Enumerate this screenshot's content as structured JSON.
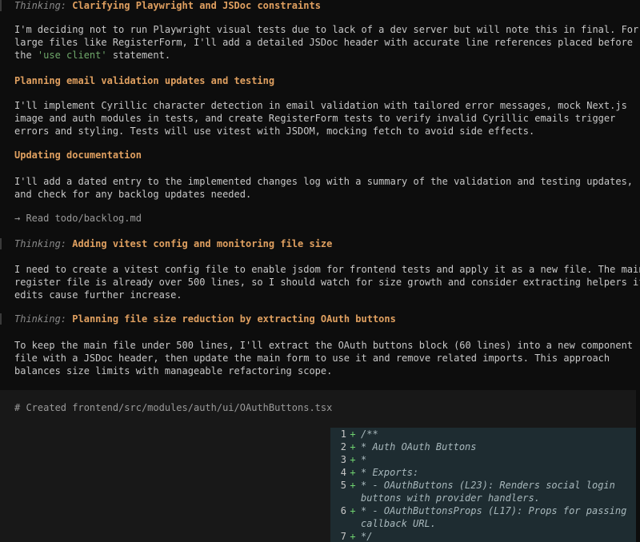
{
  "blocks": [
    {
      "type": "thinking",
      "label": "Thinking:",
      "title": "Clarifying Playwright and JSDoc constraints"
    },
    {
      "type": "para",
      "text_before": "I'm deciding not to run Playwright visual tests due to lack of a dev server but will note this in final. For large files like RegisterForm, I'll add a detailed JSDoc header with accurate line references placed before the ",
      "accent": "'use client'",
      "text_after": " statement."
    },
    {
      "type": "heading",
      "title": "Planning email validation updates and testing"
    },
    {
      "type": "para",
      "text": "I'll implement Cyrillic character detection in email validation with tailored error messages, mock Next.js image and auth modules in tests, and create RegisterForm tests to verify invalid Cyrillic emails trigger errors and styling. Tests will use vitest with JSDOM, mocking fetch to avoid side effects."
    },
    {
      "type": "heading",
      "title": "Updating documentation"
    },
    {
      "type": "para",
      "text": "I'll add a dated entry to the implemented changes log with a summary of the validation and testing updates, and check for any backlog updates needed."
    },
    {
      "type": "tool",
      "text": "→ Read todo/backlog.md"
    },
    {
      "type": "thinking",
      "label": "Thinking:",
      "title": "Adding vitest config and monitoring file size"
    },
    {
      "type": "para",
      "text": "I need to create a vitest config file to enable jsdom for frontend tests and apply it as a new file. The main register file is already over 500 lines, so I should watch for size growth and consider extracting helpers if edits cause further increase."
    },
    {
      "type": "thinking",
      "label": "Thinking:",
      "title": "Planning file size reduction by extracting OAuth buttons"
    },
    {
      "type": "para",
      "text": "To keep the main file under 500 lines, I'll extract the OAuth buttons block (60 lines) into a new component file with a JSDoc header, then update the main form to use it and remove related imports. This approach balances size limits with manageable refactoring scope."
    }
  ],
  "panel": {
    "title": "# Created frontend/src/modules/auth/ui/OAuthButtons.tsx",
    "diff": [
      {
        "n": "1",
        "sign": "+",
        "code": "/**"
      },
      {
        "n": "2",
        "sign": "+",
        "code": " * Auth OAuth Buttons"
      },
      {
        "n": "3",
        "sign": "+",
        "code": " *"
      },
      {
        "n": "4",
        "sign": "+",
        "code": " * Exports:"
      },
      {
        "n": "5",
        "sign": "+",
        "code": " * - OAuthButtons (L23): Renders social login buttons with provider handlers."
      },
      {
        "n": "6",
        "sign": "+",
        "code": " * - OAuthButtonsProps (L17): Props for passing callback URL."
      },
      {
        "n": "7",
        "sign": "+",
        "code": " */"
      }
    ]
  }
}
